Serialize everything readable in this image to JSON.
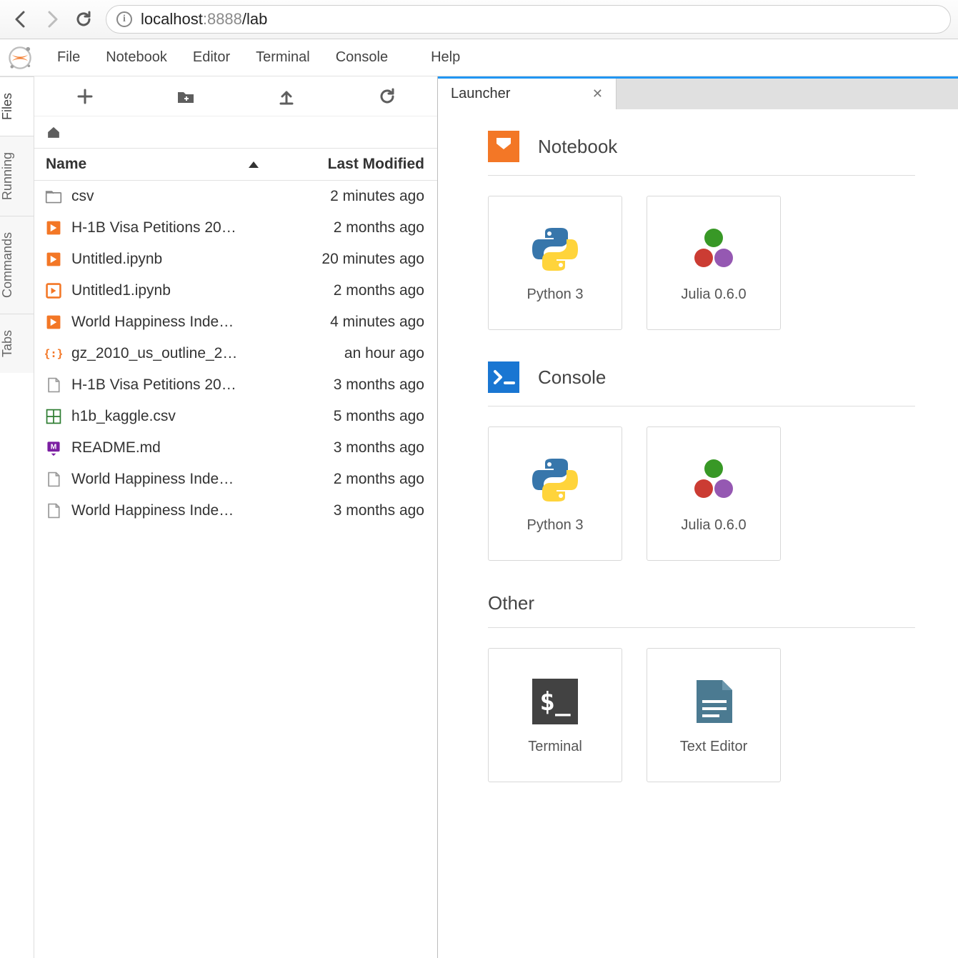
{
  "browser": {
    "url_host": "localhost",
    "url_port": ":8888",
    "url_path": "/lab"
  },
  "menu": {
    "items": [
      "File",
      "Notebook",
      "Editor",
      "Terminal",
      "Console",
      "Help"
    ]
  },
  "activity": {
    "tabs": [
      "Files",
      "Running",
      "Commands",
      "Tabs"
    ],
    "active": 0
  },
  "filebrowser": {
    "columns": {
      "name": "Name",
      "modified": "Last Modified"
    },
    "rows": [
      {
        "icon": "folder",
        "name": "csv",
        "modified": "2 minutes ago"
      },
      {
        "icon": "nb",
        "name": "H-1B Visa Petitions 20…",
        "modified": "2 months ago"
      },
      {
        "icon": "nb",
        "name": "Untitled.ipynb",
        "modified": "20 minutes ago"
      },
      {
        "icon": "nb-run",
        "name": "Untitled1.ipynb",
        "modified": "2 months ago"
      },
      {
        "icon": "nb",
        "name": "World Happiness Inde…",
        "modified": "4 minutes ago"
      },
      {
        "icon": "json",
        "name": "gz_2010_us_outline_2…",
        "modified": "an hour ago"
      },
      {
        "icon": "file",
        "name": "H-1B Visa Petitions 20…",
        "modified": "3 months ago"
      },
      {
        "icon": "csv",
        "name": "h1b_kaggle.csv",
        "modified": "5 months ago"
      },
      {
        "icon": "md",
        "name": "README.md",
        "modified": "3 months ago"
      },
      {
        "icon": "file",
        "name": "World Happiness Inde…",
        "modified": "2 months ago"
      },
      {
        "icon": "file",
        "name": "World Happiness Inde…",
        "modified": "3 months ago"
      }
    ]
  },
  "tab": {
    "title": "Launcher"
  },
  "launcher": {
    "sections": [
      {
        "kind": "notebook",
        "title": "Notebook",
        "cards": [
          {
            "icon": "python",
            "label": "Python 3"
          },
          {
            "icon": "julia",
            "label": "Julia 0.6.0"
          }
        ]
      },
      {
        "kind": "console",
        "title": "Console",
        "cards": [
          {
            "icon": "python",
            "label": "Python 3"
          },
          {
            "icon": "julia",
            "label": "Julia 0.6.0"
          }
        ]
      },
      {
        "kind": "other",
        "title": "Other",
        "cards": [
          {
            "icon": "terminal",
            "label": "Terminal"
          },
          {
            "icon": "texted",
            "label": "Text Editor"
          }
        ]
      }
    ]
  }
}
